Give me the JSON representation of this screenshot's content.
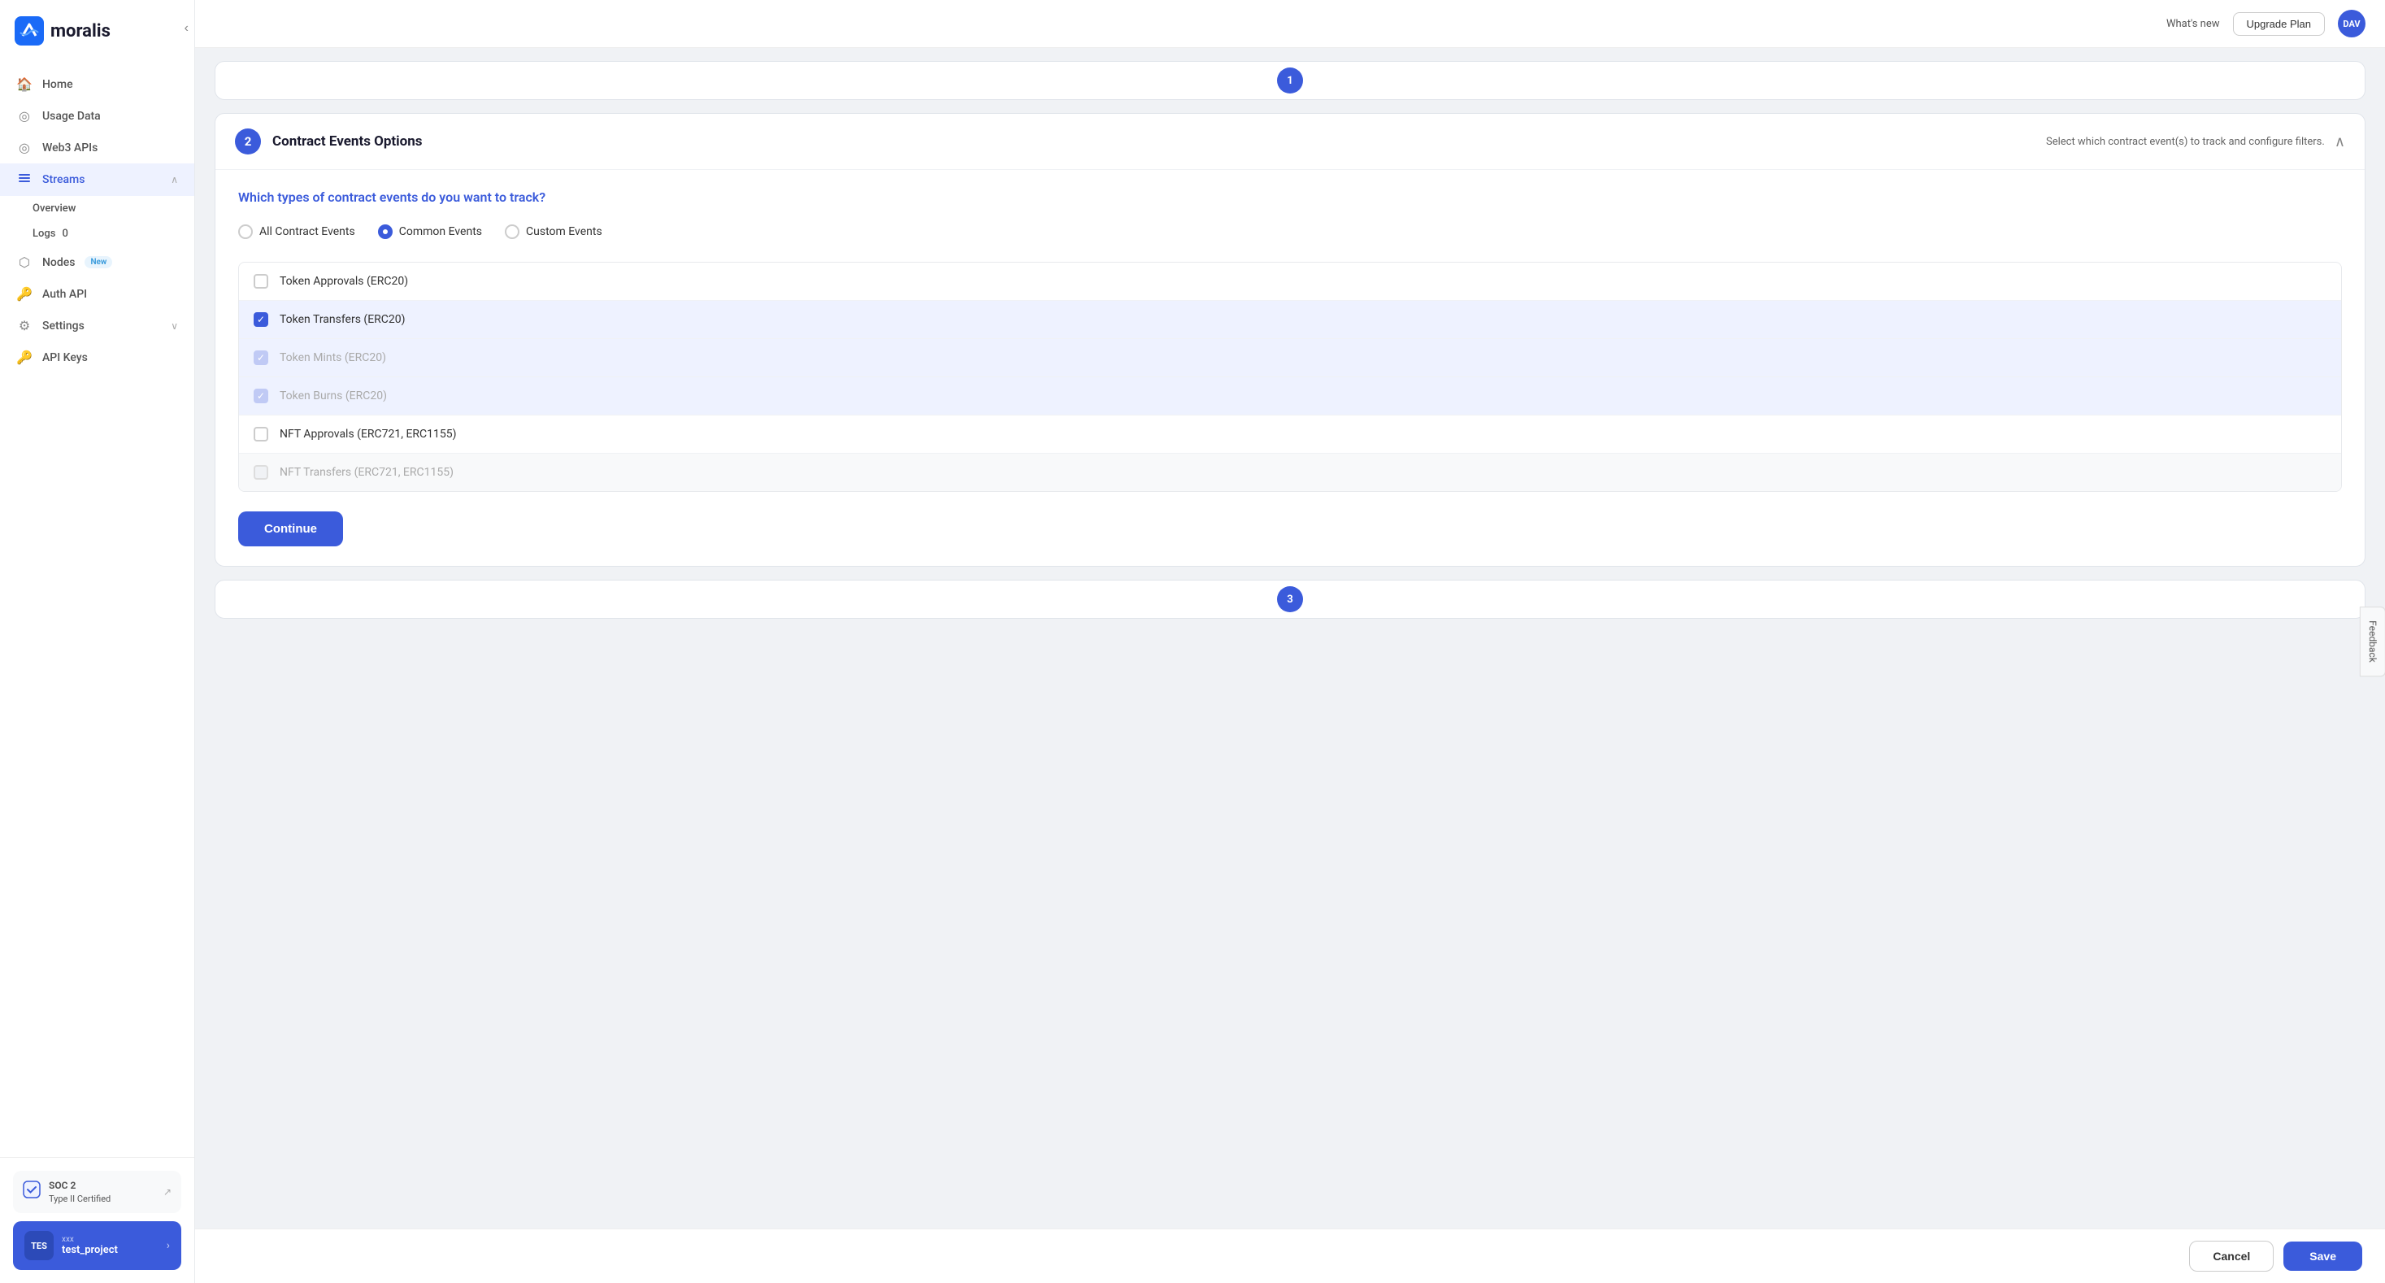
{
  "sidebar": {
    "logo": "moralis",
    "collapse_label": "‹",
    "nav_items": [
      {
        "id": "home",
        "label": "Home",
        "icon": "🏠",
        "active": false
      },
      {
        "id": "usage-data",
        "label": "Usage Data",
        "icon": "◎",
        "active": false
      },
      {
        "id": "web3-apis",
        "label": "Web3 APIs",
        "icon": "◎",
        "active": false
      },
      {
        "id": "streams",
        "label": "Streams",
        "icon": "📶",
        "active": true,
        "expanded": true
      },
      {
        "id": "nodes",
        "label": "Nodes",
        "icon": "⬡",
        "active": false,
        "badge": "New"
      },
      {
        "id": "auth-api",
        "label": "Auth API",
        "icon": "🔑",
        "active": false
      },
      {
        "id": "settings",
        "label": "Settings",
        "icon": "⚙",
        "active": false,
        "has_chevron": true
      },
      {
        "id": "api-keys",
        "label": "API Keys",
        "icon": "🔑",
        "active": false
      }
    ],
    "streams_sub": [
      {
        "id": "overview",
        "label": "Overview"
      },
      {
        "id": "logs",
        "label": "Logs",
        "badge": "0"
      }
    ],
    "soc": {
      "label1": "SOC 2",
      "label2": "Type II Certified",
      "link": "↗"
    },
    "project": {
      "avatar": "TES",
      "label": "xxx",
      "name": "test_project",
      "arrow": "›"
    }
  },
  "topbar": {
    "whats_new": "What's new",
    "upgrade_btn": "Upgrade Plan",
    "user_avatar": "DAV"
  },
  "page": {
    "section_number": "2",
    "section_title": "Contract Events Options",
    "section_subtitle": "Select which contract event(s) to track and configure filters.",
    "question": "Which types of contract events do you want to track?",
    "radio_options": [
      {
        "id": "all",
        "label": "All Contract Events",
        "selected": false
      },
      {
        "id": "common",
        "label": "Common Events",
        "selected": true
      },
      {
        "id": "custom",
        "label": "Custom Events",
        "selected": false
      }
    ],
    "checkboxes": [
      {
        "id": "token-approvals",
        "label": "Token Approvals (ERC20)",
        "checked": false,
        "disabled": false,
        "disabled_checked": false
      },
      {
        "id": "token-transfers",
        "label": "Token Transfers (ERC20)",
        "checked": true,
        "disabled": false,
        "disabled_checked": false
      },
      {
        "id": "token-mints",
        "label": "Token Mints (ERC20)",
        "checked": false,
        "disabled": true,
        "disabled_checked": true
      },
      {
        "id": "token-burns",
        "label": "Token Burns (ERC20)",
        "checked": false,
        "disabled": true,
        "disabled_checked": true
      },
      {
        "id": "nft-approvals",
        "label": "NFT Approvals (ERC721, ERC1155)",
        "checked": false,
        "disabled": false,
        "disabled_checked": false
      },
      {
        "id": "nft-transfers",
        "label": "NFT Transfers (ERC721, ERC1155)",
        "checked": false,
        "disabled": true,
        "disabled_checked": false
      }
    ],
    "continue_btn": "Continue",
    "cancel_btn": "Cancel",
    "save_btn": "Save"
  },
  "feedback": "Feedback"
}
